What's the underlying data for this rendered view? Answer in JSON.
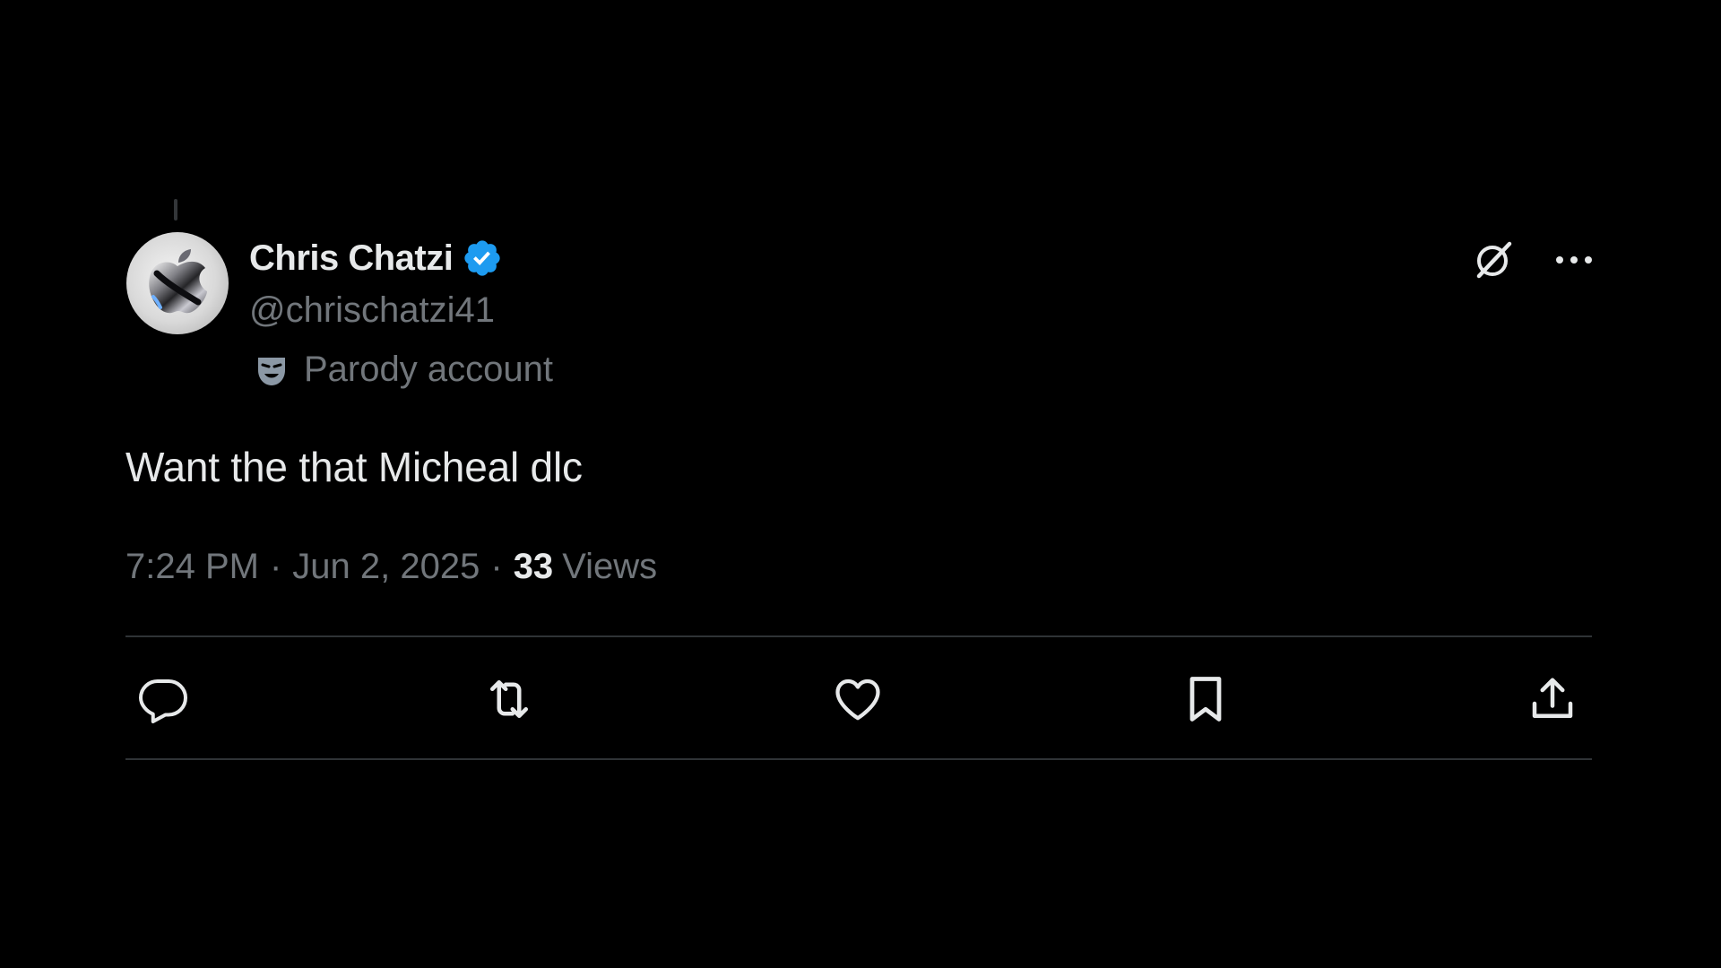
{
  "colors": {
    "background": "#000000",
    "primary_text": "#e7e9ea",
    "secondary_text": "#71767b",
    "divider": "#2f3336",
    "verified": "#1d9bf0"
  },
  "author": {
    "display_name": "Chris Chatzi",
    "handle": "@chrischatzi41",
    "verified": true,
    "avatar_icon": "apple-logo-avatar",
    "label": "Parody account",
    "label_icon": "mask-icon"
  },
  "header_actions": [
    {
      "name": "grok-icon"
    },
    {
      "name": "more-options-icon"
    }
  ],
  "tweet": {
    "text": "Want the that Micheal dlc",
    "time": "7:24 PM",
    "separator": "·",
    "date": "Jun 2, 2025",
    "views_count": "33",
    "views_label": "Views"
  },
  "actions": [
    {
      "name": "reply-icon"
    },
    {
      "name": "retweet-icon"
    },
    {
      "name": "like-icon"
    },
    {
      "name": "bookmark-icon"
    },
    {
      "name": "share-icon"
    }
  ]
}
